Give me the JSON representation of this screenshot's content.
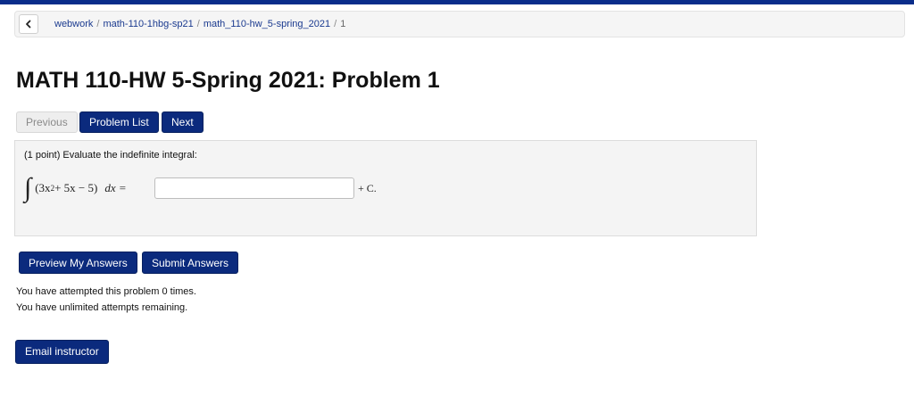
{
  "breadcrumb": {
    "items": [
      "webwork",
      "math-110-1hbg-sp21",
      "math_110-hw_5-spring_2021"
    ],
    "current": "1",
    "separator": "/"
  },
  "page_title": "MATH 110-HW 5-Spring 2021: Problem 1",
  "nav": {
    "previous_label": "Previous",
    "problem_list_label": "Problem List",
    "next_label": "Next"
  },
  "problem": {
    "prompt": "(1 point) Evaluate the indefinite integral:",
    "integral_symbol": "∫",
    "integrand_open": "(3x",
    "exponent": "2",
    "integrand_rest": " + 5x − 5)",
    "differential": "dx =",
    "answer_value": "",
    "constant": "+ C."
  },
  "actions": {
    "preview_label": "Preview My Answers",
    "submit_label": "Submit Answers"
  },
  "status": {
    "attempts_line": "You have attempted this problem 0 times.",
    "remaining_line": "You have unlimited attempts remaining."
  },
  "email_label": "Email instructor",
  "colors": {
    "primary": "#0b2a7d",
    "topbar": "#0a2d8a",
    "link": "#1a3a8f"
  }
}
